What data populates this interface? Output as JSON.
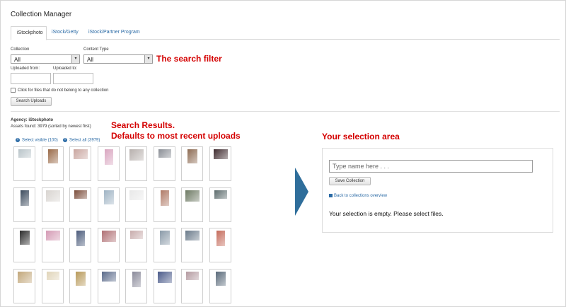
{
  "page_title": "Collection Manager",
  "tabs": [
    {
      "label": "iStockphoto",
      "active": true
    },
    {
      "label": "iStock/Getty",
      "active": false
    },
    {
      "label": "iStock/Partner Program",
      "active": false
    }
  ],
  "filters": {
    "collection_label": "Collection",
    "collection_value": "All",
    "content_type_label": "Content Type",
    "content_type_value": "All",
    "uploaded_from_label": "Uploaded from:",
    "uploaded_to_label": "Uploaded to:",
    "checkbox_label": "Click for files that do not belong to any collection",
    "search_button": "Search Uploads"
  },
  "annotations": {
    "search_filter": "The search filter",
    "results_line1": "Search Results.",
    "results_line2": "Defaults to most recent uploads",
    "selection_area": "Your selection area"
  },
  "results": {
    "agency_line": "Agency: iStockphoto",
    "assets_line": "Assets found: 3979 (sorted by newest first)",
    "select_visible": "Select visible (100)",
    "select_all": "Select all (3979)"
  },
  "selection": {
    "name_placeholder": "Type name here . . .",
    "save_button": "Save Collection",
    "back_link": "Back to collections overview",
    "empty_message": "Your selection is empty. Please select files."
  },
  "colors": {
    "annotation_red": "#d40000",
    "link_blue": "#2a6aa5",
    "arrow_blue": "#2f6e9b"
  },
  "thumbnails": [
    [
      "#b9c4c9",
      "#9a6a48",
      "#c9a6a0",
      "#d9a6c0",
      "#b7b0ad",
      "#8a8e95",
      "#8d6b53",
      "#3e2a2e"
    ],
    [
      "#3b4a5c",
      "#d8d4d0",
      "#7a4c3a",
      "#a0b4c4",
      "#e8e8e8",
      "#b07a66",
      "#6e7a64",
      "#5c6b6c"
    ],
    [
      "#2a2a2a",
      "#d49ab4",
      "#4a5a7a",
      "#b07074",
      "#c8acac",
      "#8a9aa8",
      "#6a7a8a",
      "#c46a5a"
    ],
    [
      "#c2a77a",
      "#e0d4b8",
      "#b89a5a",
      "#5a6a8a",
      "#8a8a9a",
      "#4a5a8a",
      "#b49aa0",
      "#5a6a7a"
    ]
  ]
}
